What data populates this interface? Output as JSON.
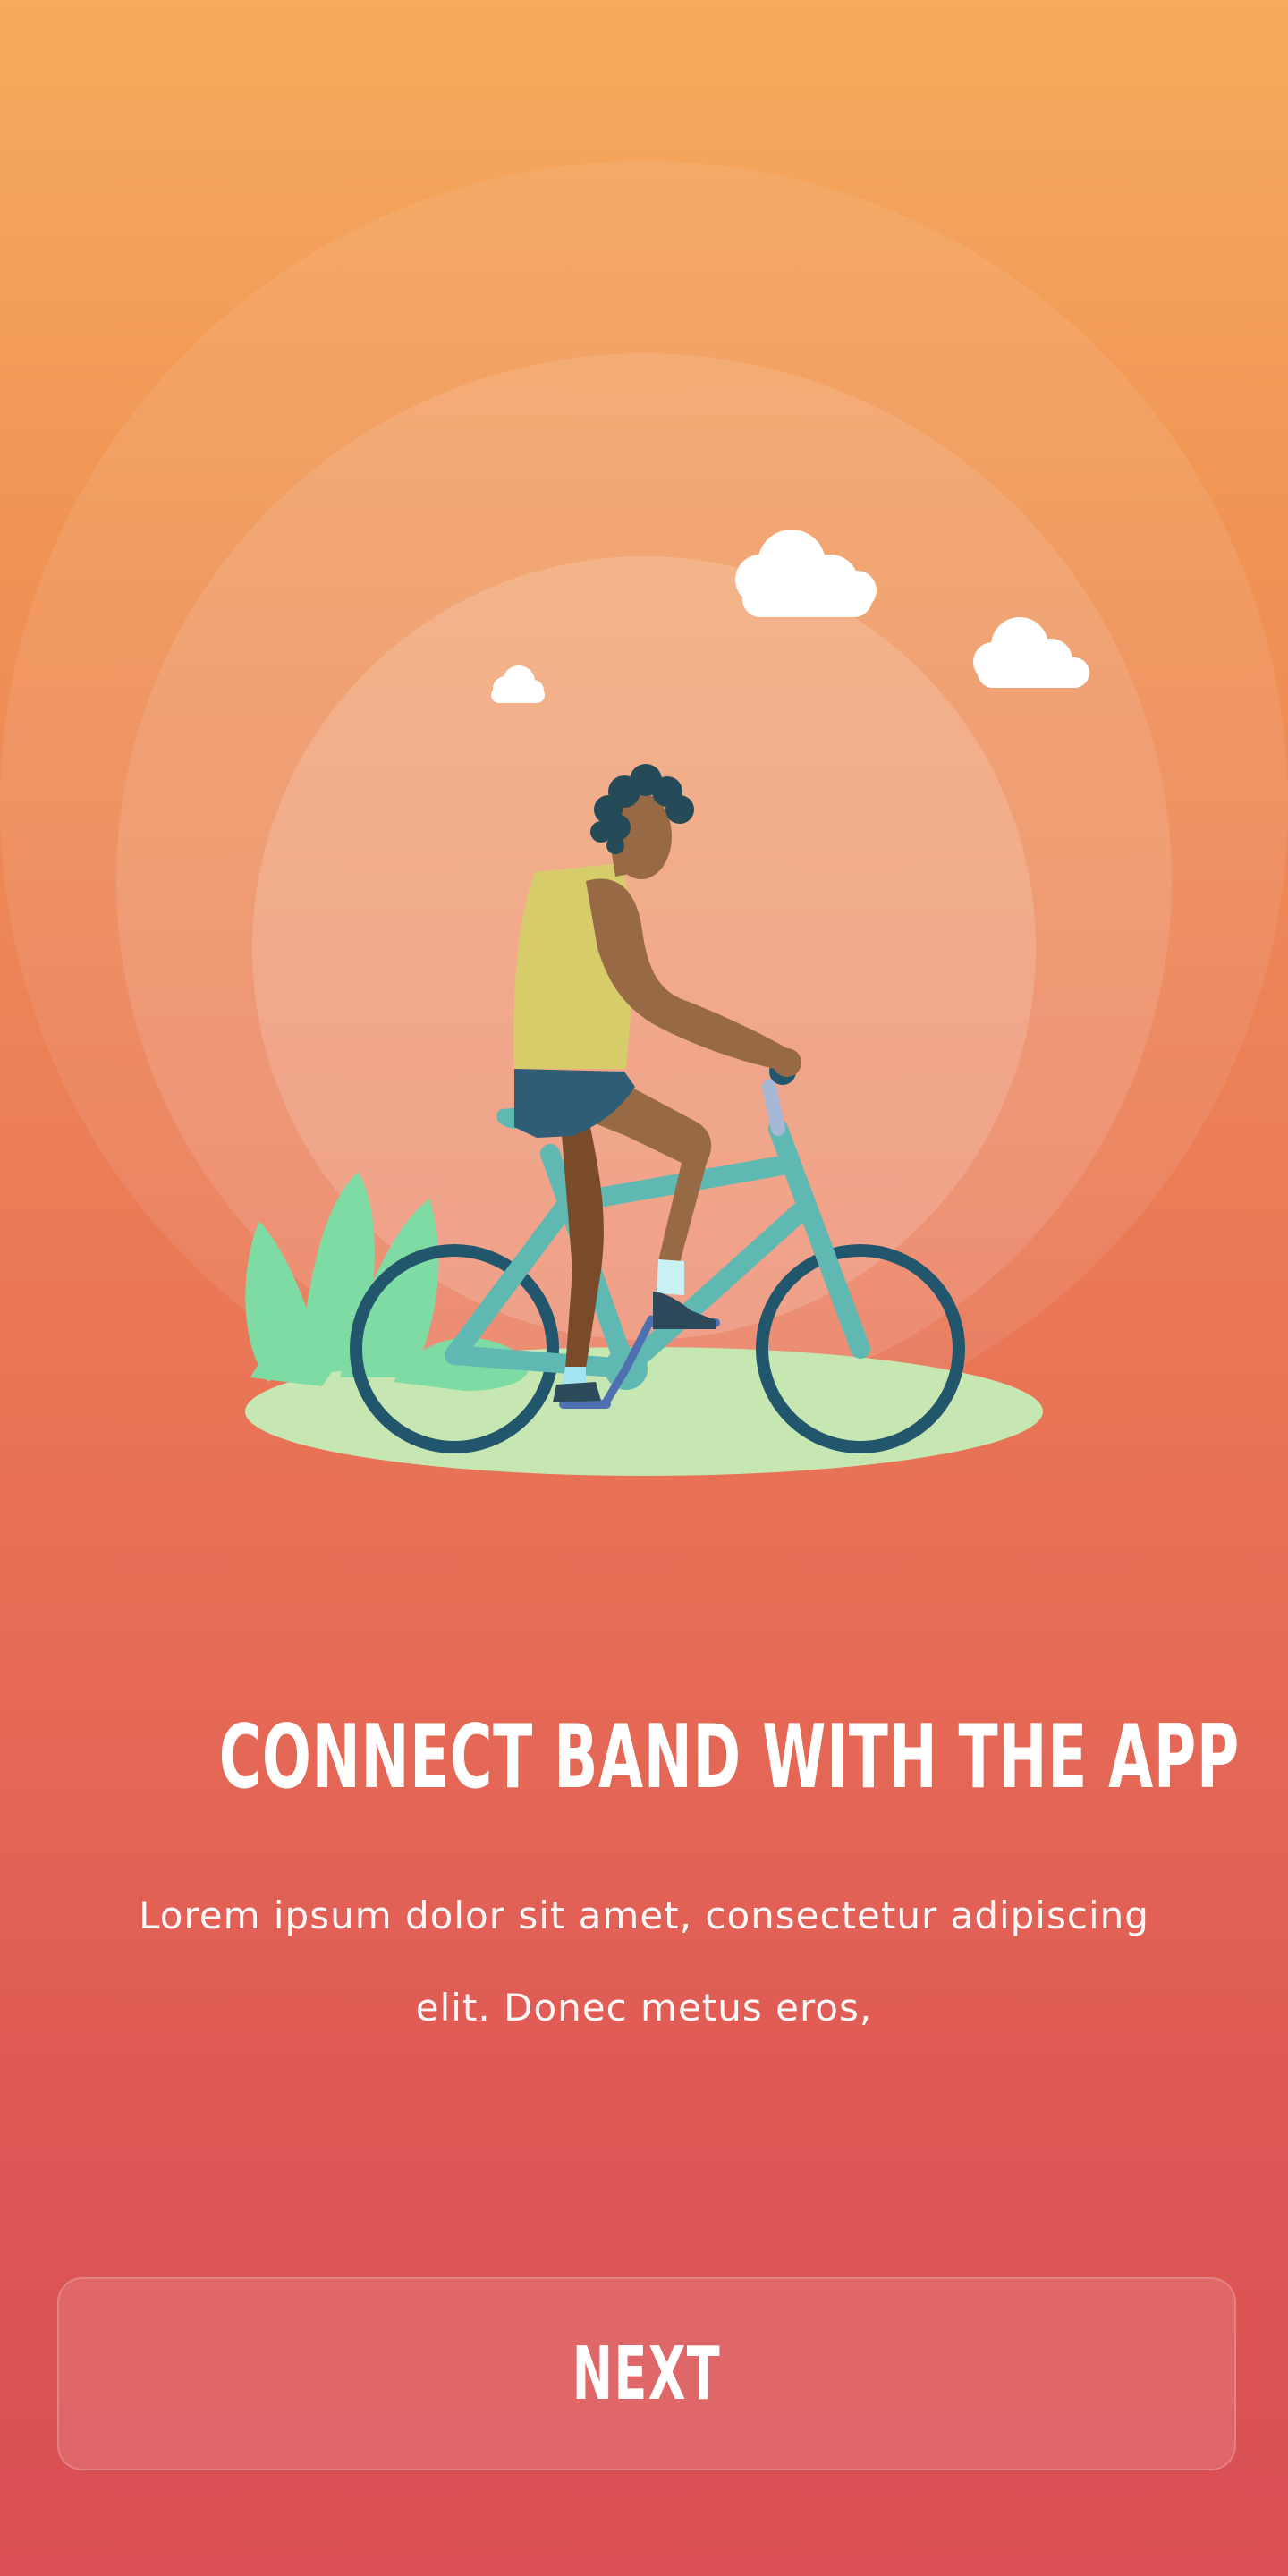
{
  "screen": {
    "name": "onboarding",
    "colors": {
      "gradient_top": "#f7ab5e",
      "gradient_bottom": "#d94f53",
      "text": "#ffffff"
    }
  },
  "illustration": {
    "subject": "person-riding-bicycle-icon",
    "elements": [
      "cloud-icon",
      "cloud-icon",
      "cloud-icon",
      "bush-icon",
      "bicycle-icon",
      "cyclist-icon",
      "grass-patch-icon"
    ]
  },
  "onboarding": {
    "title": "CONNECT BAND WITH THE APP",
    "description": "Lorem ipsum dolor sit amet, consectetur adipiscing elit. Donec metus eros,",
    "next_label": "NEXT"
  }
}
